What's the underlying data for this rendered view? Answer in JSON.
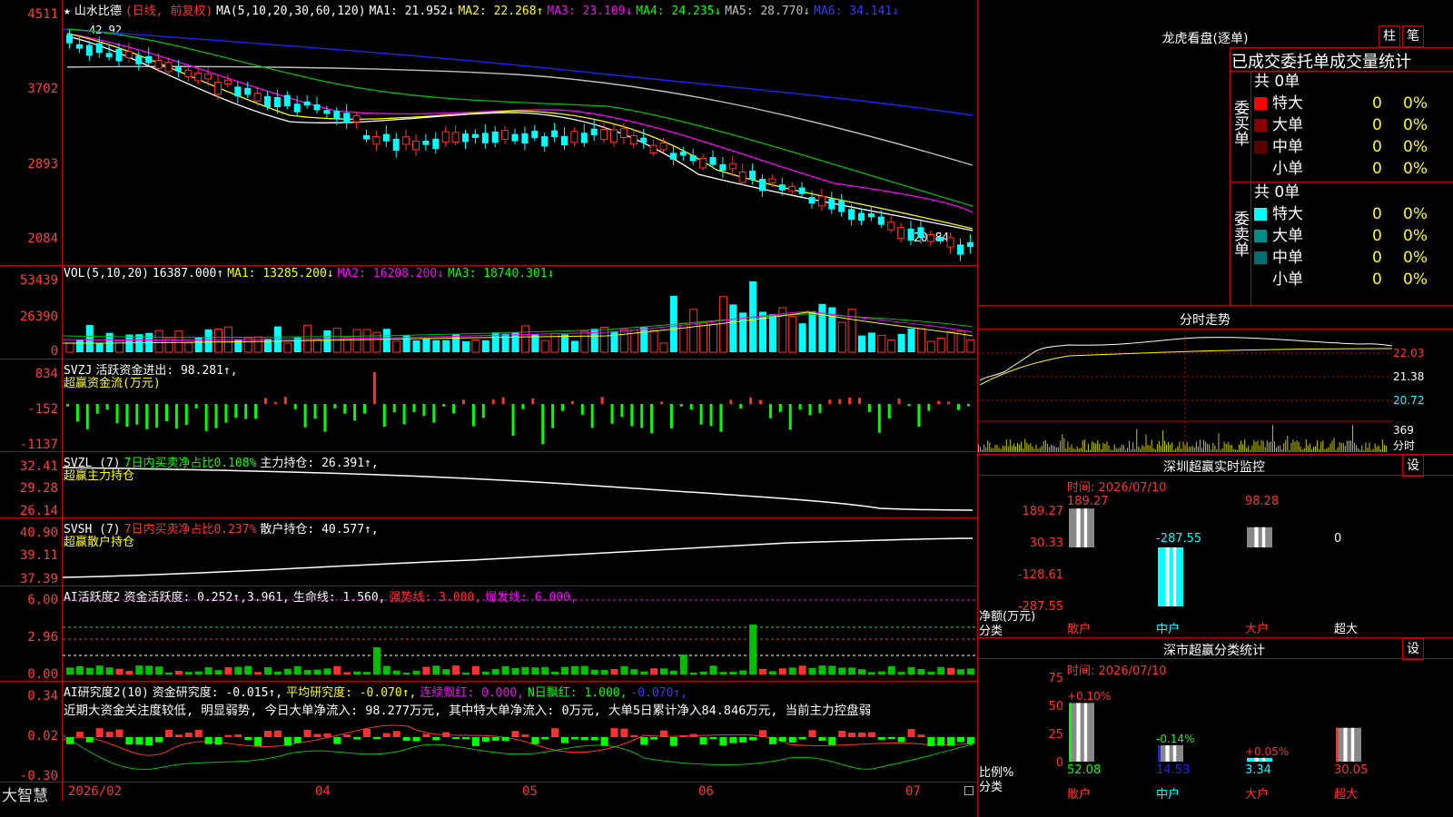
{
  "stock": {
    "name": "山水比德",
    "mode": "(日线, 前复权)",
    "ma_params": "MA(5,10,20,30,60,120)",
    "ma": [
      {
        "label": "MA1:",
        "value": "21.952↓",
        "color": "#ffffff"
      },
      {
        "label": "MA2:",
        "value": "22.268↑",
        "color": "#ffff00"
      },
      {
        "label": "MA3:",
        "value": "23.109↓",
        "color": "#ff00ff"
      },
      {
        "label": "MA4:",
        "value": "24.235↓",
        "color": "#00ff00"
      },
      {
        "label": "MA5:",
        "value": "28.770↓",
        "color": "#c0c0c0"
      },
      {
        "label": "MA6:",
        "value": "34.141↓",
        "color": "#3a3aff"
      }
    ],
    "high_mark": "42.92",
    "low_mark": "20.84",
    "price_axis": [
      "4511",
      "3702",
      "2893",
      "2084"
    ]
  },
  "vol": {
    "header": "VOL(5,10,20)",
    "value": "16387.000↑",
    "ma": [
      {
        "label": "MA1:",
        "value": "13285.200↓",
        "color": "#ffff00"
      },
      {
        "label": "MA2:",
        "value": "16208.200↓",
        "color": "#ff00ff"
      },
      {
        "label": "MA3:",
        "value": "18740.301↓",
        "color": "#00ff00"
      }
    ],
    "axis": [
      "53439",
      "26390",
      "0"
    ]
  },
  "svzj": {
    "header": "SVZJ",
    "active": "活跃资金进出: 98.281↑,",
    "sub": "超赢资金流(万元)",
    "axis": [
      "834",
      "-152",
      "-1137"
    ]
  },
  "svzl": {
    "header": "SVZL (7)",
    "net": "7日内买卖净占比0.108%",
    "hold": "主力持仓: 26.391↑,",
    "sub": "超赢主力持仓",
    "axis": [
      "32.41",
      "29.28",
      "26.14"
    ]
  },
  "svsh": {
    "header": "SVSH (7)",
    "net": "7日内买卖净占比0.237%",
    "hold": "散户持仓: 40.577↑,",
    "sub": "超赢散户持仓",
    "axis": [
      "40.90",
      "39.11",
      "37.39"
    ]
  },
  "ai_active": {
    "header": "AI活跃度2",
    "v1": "资金活跃度: 0.252↑,3.961,",
    "v2": "生命线: 1.560,",
    "v3": "强势线: 3.000,",
    "v4": "爆发线: 6.000,",
    "axis": [
      "6.00",
      "2.96",
      "0.00"
    ]
  },
  "ai_research": {
    "header": "AI研究度2(10)",
    "v1": "资金研究度: -0.015↑,",
    "v2": "平均研究度: -0.070↑,",
    "v3": "连续飘红: 0.000,",
    "v4": "N日飘红: 1.000,",
    "v5": "-0.070↑,",
    "comment": "近期大资金关注度较低, 明显弱势, 今日大单净流入: 98.277万元, 其中特大单净流入: 0万元, 大单5日累计净入84.846万元, 当前主力控盘弱",
    "axis": [
      "0.34",
      "0.02",
      "-0.30"
    ]
  },
  "bottom": {
    "brand": "大智慧",
    "dates": [
      "2026/02",
      "04",
      "05",
      "06",
      "07"
    ]
  },
  "right": {
    "top_title": "龙虎看盘(逐单)",
    "btn_bar": "柱",
    "btn_note": "笔",
    "stat_title": "已成交委托单成交量统计",
    "buy_label": "委买单",
    "sell_label": "委卖单",
    "buy_total": "共 0单",
    "sell_total": "共 0单",
    "buy_rows": [
      {
        "name": "特大",
        "count": "0",
        "pct": "0%",
        "color": "#ff0000"
      },
      {
        "name": "大单",
        "count": "0",
        "pct": "0%",
        "color": "#8b0000"
      },
      {
        "name": "中单",
        "count": "0",
        "pct": "0%",
        "color": "#5a0000"
      },
      {
        "name": "小单",
        "count": "0",
        "pct": "0%",
        "color": "#000000"
      }
    ],
    "sell_rows": [
      {
        "name": "特大",
        "count": "0",
        "pct": "0%",
        "color": "#00ffff"
      },
      {
        "name": "大单",
        "count": "0",
        "pct": "0%",
        "color": "#008b8b"
      },
      {
        "name": "中单",
        "count": "0",
        "pct": "0%",
        "color": "#006e6e"
      },
      {
        "name": "小单",
        "count": "0",
        "pct": "0%",
        "color": "#000000"
      }
    ],
    "intraday_title": "分时走势",
    "intraday_axis": [
      "22.03",
      "21.38",
      "20.72"
    ],
    "intraday_vol": "369",
    "intraday_unit": "分时",
    "monitor_title": "深圳超赢实时监控",
    "monitor_time": "时间: 2026/07/10",
    "monitor_axis": [
      "189.27",
      "30.33",
      "-128.61",
      "-287.55"
    ],
    "monitor_unit": "净额(万元)",
    "monitor_cat": "分类",
    "monitor_values": [
      "189.27",
      "-287.55",
      "98.28",
      "0"
    ],
    "monitor_cats": [
      "散户",
      "中户",
      "大户",
      "超大"
    ],
    "class_title": "深市超赢分类统计",
    "class_time": "时间: 2026/07/10",
    "class_axis": [
      "75",
      "50",
      "25",
      "0"
    ],
    "class_unit": "比例%",
    "class_cat": "分类",
    "class_changes": [
      "+0.10%",
      "-0.14%",
      "+0.05%",
      ""
    ],
    "class_values": [
      "52.08",
      "14.53",
      "3.34",
      "30.05"
    ],
    "class_cats": [
      "散户",
      "中户",
      "大户",
      "超大"
    ],
    "settings": "设"
  },
  "chart_data": [
    {
      "type": "line",
      "title": "山水比德 日线",
      "ylim": [
        20.84,
        42.92
      ],
      "series": [
        {
          "name": "MA1",
          "values": [
            21.95
          ]
        },
        {
          "name": "MA6",
          "values": [
            34.14
          ]
        }
      ]
    },
    {
      "type": "bar",
      "title": "超赢分类统计",
      "categories": [
        "散户",
        "中户",
        "大户",
        "超大"
      ],
      "values": [
        52.08,
        14.53,
        3.34,
        30.05
      ],
      "ylim": [
        0,
        75
      ]
    },
    {
      "type": "bar",
      "title": "超赢实时监控",
      "categories": [
        "散户",
        "中户",
        "大户",
        "超大"
      ],
      "values": [
        189.27,
        -287.55,
        98.28,
        0
      ]
    }
  ]
}
